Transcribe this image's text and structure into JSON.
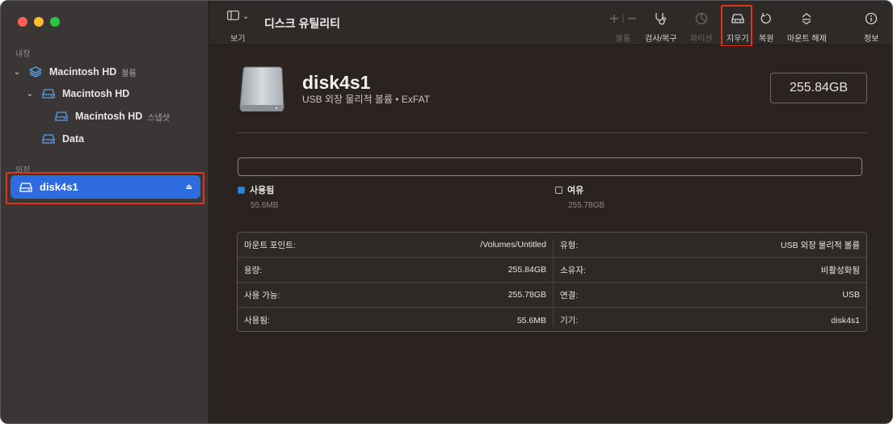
{
  "sidebar": {
    "internal_label": "내장",
    "external_label": "외장",
    "items": [
      {
        "label": "Macintosh HD",
        "sub": "볼륨"
      },
      {
        "label": "Macintosh HD",
        "sub": ""
      },
      {
        "label": "Macintosh HD",
        "sub": "스냅샷"
      },
      {
        "label": "Data",
        "sub": ""
      }
    ],
    "selected": {
      "label": "disk4s1",
      "eject": "⏏"
    }
  },
  "toolbar": {
    "view_label": "보기",
    "title": "디스크 유틸리티",
    "buttons": [
      {
        "label": "볼륨",
        "icon": "plus-minus-icon",
        "enabled": false
      },
      {
        "label": "검사/복구",
        "icon": "stethoscope-icon",
        "enabled": true
      },
      {
        "label": "파티션",
        "icon": "pie-chart-icon",
        "enabled": false
      },
      {
        "label": "지우기",
        "icon": "erase-disk-icon",
        "enabled": true
      },
      {
        "label": "복원",
        "icon": "restore-icon",
        "enabled": true
      },
      {
        "label": "마운트 해제",
        "icon": "unmount-icon",
        "enabled": true
      },
      {
        "label": "정보",
        "icon": "info-icon",
        "enabled": true
      }
    ]
  },
  "disk": {
    "name": "disk4s1",
    "description": "USB 외장 물리적 볼륨 • ExFAT",
    "capacity": "255.84GB"
  },
  "usage": {
    "used_label": "사용됨",
    "used_value": "55.6MB",
    "used_color": "#2a86d9",
    "free_label": "여유",
    "free_value": "255.78GB"
  },
  "info": {
    "left": [
      {
        "key": "마운트 포인트:",
        "value": "/Volumes/Untitled"
      },
      {
        "key": "용량:",
        "value": "255.84GB"
      },
      {
        "key": "사용 가능:",
        "value": "255.78GB"
      },
      {
        "key": "사용됨:",
        "value": "55.6MB"
      }
    ],
    "right": [
      {
        "key": "유형:",
        "value": "USB 외장 물리적 볼륨"
      },
      {
        "key": "소유자:",
        "value": "비활성화됨"
      },
      {
        "key": "연결:",
        "value": "USB"
      },
      {
        "key": "기기:",
        "value": "disk4s1"
      }
    ]
  }
}
